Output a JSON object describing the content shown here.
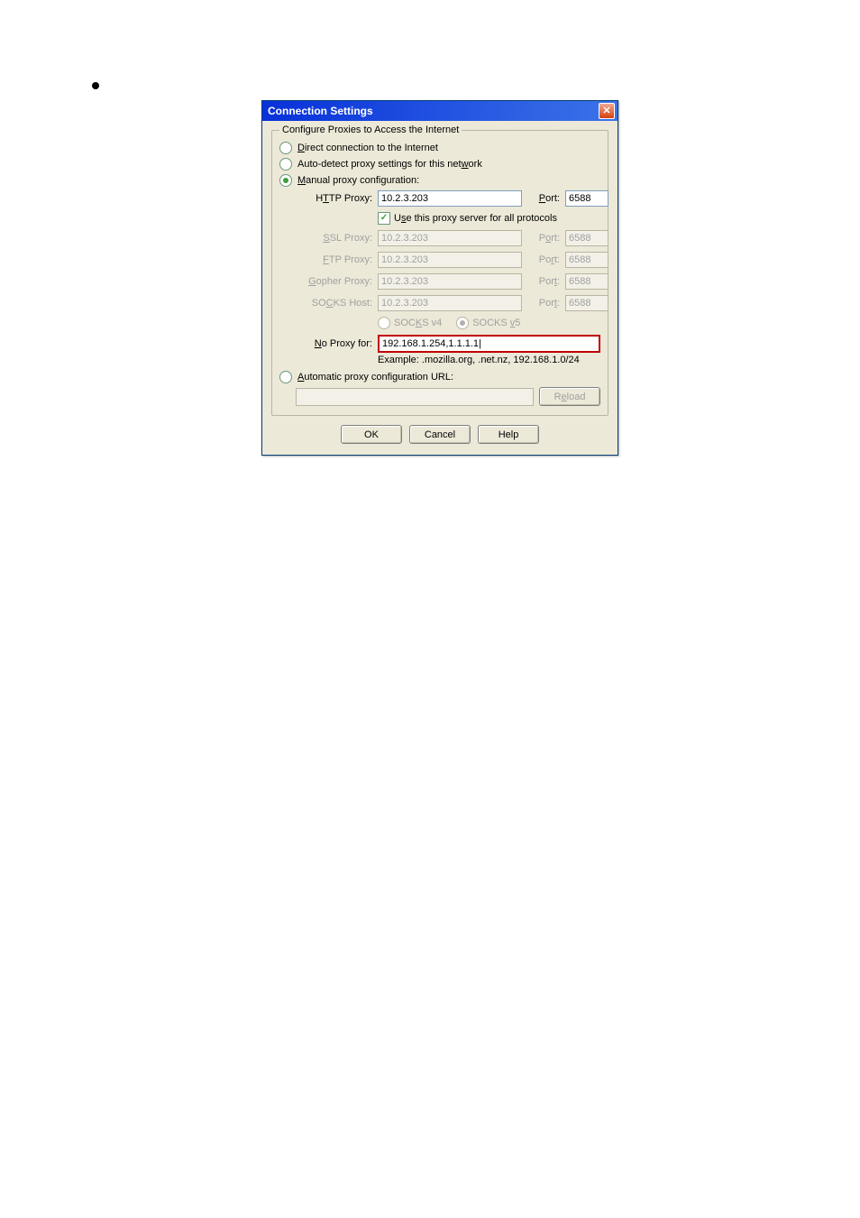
{
  "dialog": {
    "title": "Connection Settings",
    "groupTitle": "Configure Proxies to Access the Internet",
    "radios": {
      "direct": "Direct connection to the Internet",
      "autodetect": "Auto-detect proxy settings for this network",
      "manual": "Manual proxy configuration:",
      "autourl": "Automatic proxy configuration URL:"
    },
    "labels": {
      "http": "HTTP Proxy:",
      "ssl": "SSL Proxy:",
      "ftp": "FTP Proxy:",
      "gopher": "Gopher Proxy:",
      "socks": "SOCKS Host:",
      "port": "Port:",
      "noproxy": "No Proxy for:",
      "useAll": "Use this proxy server for all protocols",
      "socksv4": "SOCKS v4",
      "socksv5": "SOCKS v5",
      "example": "Example: .mozilla.org, .net.nz, 192.168.1.0/24"
    },
    "values": {
      "httpHost": "10.2.3.203",
      "httpPort": "6588",
      "sslHost": "10.2.3.203",
      "sslPort": "6588",
      "ftpHost": "10.2.3.203",
      "ftpPort": "6588",
      "gopherHost": "10.2.3.203",
      "gopherPort": "6588",
      "socksHost": "10.2.3.203",
      "socksPort": "6588",
      "noproxy": "192.168.1.254,1.1.1.1|"
    },
    "buttons": {
      "reload": "Reload",
      "ok": "OK",
      "cancel": "Cancel",
      "help": "Help"
    }
  }
}
